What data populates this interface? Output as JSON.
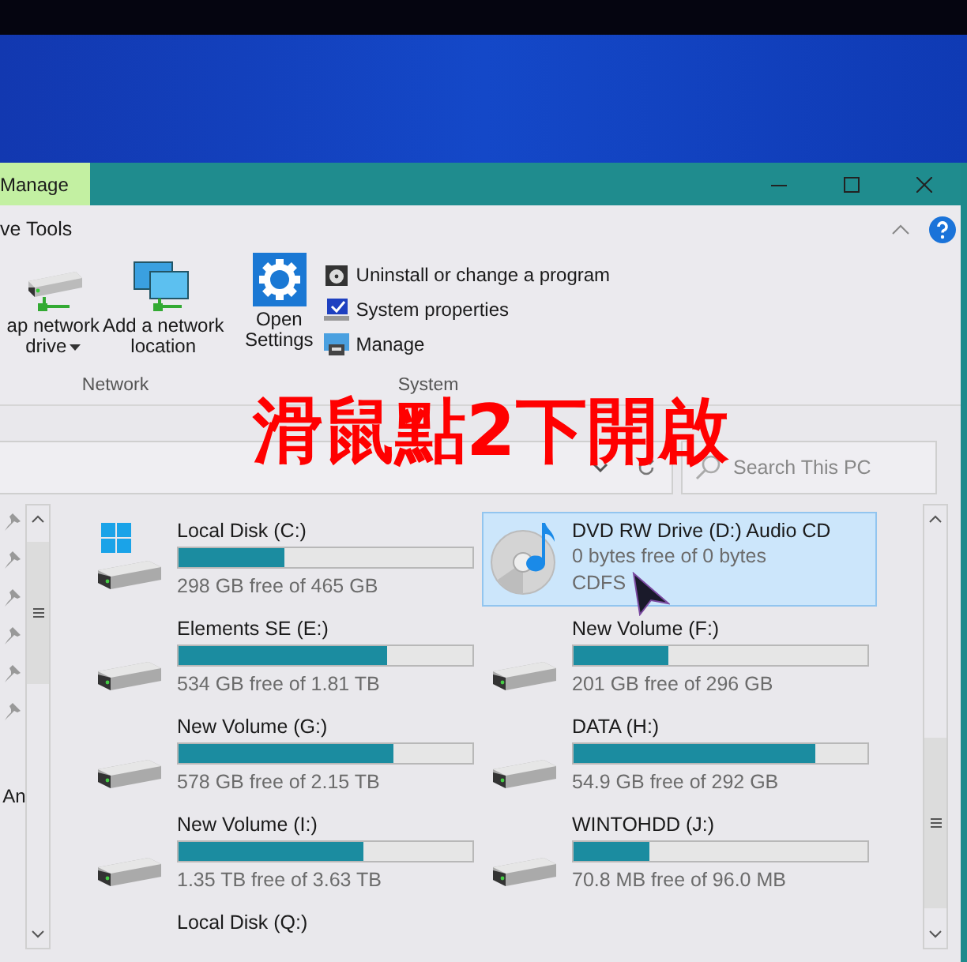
{
  "title_bar": {
    "tab": "Manage"
  },
  "ribbon": {
    "tab_label": "ve Tools",
    "network": {
      "label": "Network",
      "items": [
        {
          "kind": "map_drive",
          "lines": [
            "ap network",
            "drive"
          ],
          "dropdown": true
        },
        {
          "kind": "network_location",
          "lines": [
            "Add a network",
            "location"
          ],
          "dropdown": false
        }
      ]
    },
    "system": {
      "label": "System",
      "settings": [
        "Open",
        "Settings"
      ],
      "items": [
        {
          "kind": "program",
          "label": "Uninstall or change a program"
        },
        {
          "kind": "properties",
          "label": "System properties"
        },
        {
          "kind": "manage",
          "label": "Manage"
        }
      ]
    }
  },
  "overlay_caption": "滑鼠點2下開啟",
  "search": {
    "placeholder": "Search This PC"
  },
  "nav_pane": {
    "label": "An"
  },
  "drives": [
    {
      "kind": "system",
      "name": "Local Disk (C:)",
      "level": 0.36,
      "free": "298 GB free of 465 GB",
      "selected": false
    },
    {
      "kind": "optical",
      "name": "DVD RW Drive (D:) Audio CD",
      "free": "0 bytes free of 0 bytes",
      "file_system": "CDFS",
      "selected": true
    },
    {
      "kind": "disk",
      "name": "Elements SE (E:)",
      "level": 0.71,
      "free": "534 GB free of 1.81 TB",
      "selected": false
    },
    {
      "kind": "disk",
      "name": "New Volume (F:)",
      "level": 0.32,
      "free": "201 GB free of 296 GB",
      "selected": false
    },
    {
      "kind": "disk",
      "name": "New Volume (G:)",
      "level": 0.73,
      "free": "578 GB free of 2.15 TB",
      "selected": false
    },
    {
      "kind": "disk",
      "name": "DATA (H:)",
      "level": 0.82,
      "free": "54.9 GB free of 292 GB",
      "selected": false
    },
    {
      "kind": "disk",
      "name": "New Volume (I:)",
      "level": 0.63,
      "free": "1.35 TB free of 3.63 TB",
      "selected": false
    },
    {
      "kind": "disk",
      "name": "WINTOHDD (J:)",
      "level": 0.26,
      "free": "70.8 MB free of 96.0 MB",
      "selected": false
    },
    {
      "kind": "partial",
      "name": "Local Disk (Q:)",
      "selected": false
    }
  ]
}
